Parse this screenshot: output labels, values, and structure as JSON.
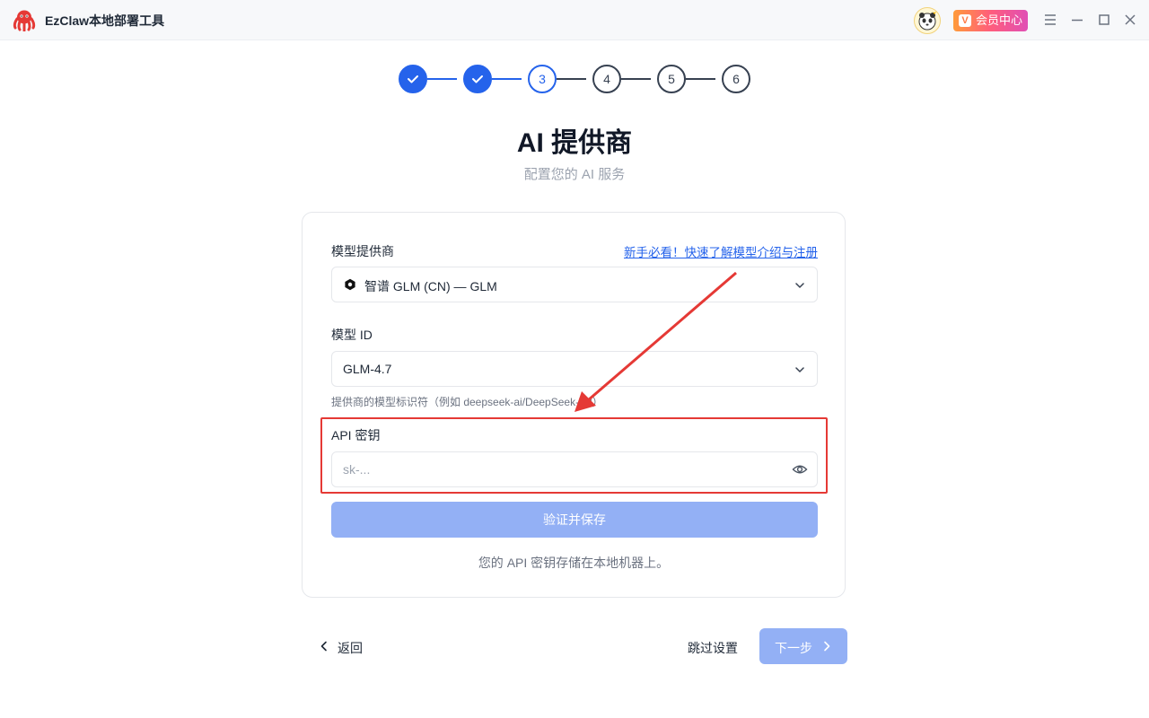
{
  "window": {
    "title": "EzClaw本地部署工具",
    "vip_label": "会员中心",
    "vip_mark": "V"
  },
  "stepper": {
    "steps": [
      {
        "label": "",
        "state": "done"
      },
      {
        "label": "",
        "state": "done"
      },
      {
        "label": "3",
        "state": "current"
      },
      {
        "label": "4",
        "state": "todo"
      },
      {
        "label": "5",
        "state": "todo"
      },
      {
        "label": "6",
        "state": "todo"
      }
    ]
  },
  "page": {
    "title": "AI 提供商",
    "subtitle": "配置您的 AI 服务"
  },
  "form": {
    "provider_label": "模型提供商",
    "guide_link": "新手必看！快速了解模型介绍与注册",
    "provider_value": "智谱 GLM (CN) — GLM",
    "model_id_label": "模型 ID",
    "model_id_value": "GLM-4.7",
    "model_id_hint": "提供商的模型标识符（例如 deepseek-ai/DeepSeek-V3）",
    "api_key_label": "API 密钥",
    "api_key_placeholder": "sk-...",
    "api_key_value": "",
    "verify_button": "验证并保存",
    "storage_note": "您的 API 密钥存储在本地机器上。"
  },
  "footer": {
    "back_label": "返回",
    "skip_label": "跳过设置",
    "next_label": "下一步"
  },
  "colors": {
    "primary": "#2563eb",
    "disabled_primary": "#93b0f5",
    "annotation_red": "#e53935"
  }
}
